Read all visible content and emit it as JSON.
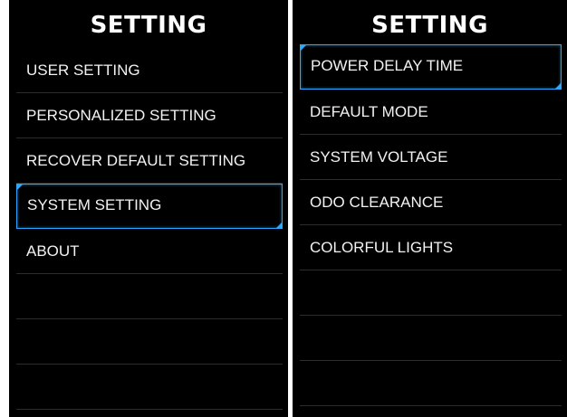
{
  "screens": [
    {
      "title": "SETTING",
      "items": [
        {
          "label": "USER SETTING",
          "selected": false
        },
        {
          "label": "PERSONALIZED SETTING",
          "selected": false
        },
        {
          "label": "RECOVER DEFAULT SETTING",
          "selected": false
        },
        {
          "label": "SYSTEM SETTING",
          "selected": true
        },
        {
          "label": "ABOUT",
          "selected": false
        }
      ]
    },
    {
      "title": "SETTING",
      "items": [
        {
          "label": "POWER DELAY TIME",
          "selected": true
        },
        {
          "label": "DEFAULT MODE",
          "selected": false
        },
        {
          "label": "SYSTEM VOLTAGE",
          "selected": false
        },
        {
          "label": "ODO CLEARANCE",
          "selected": false
        },
        {
          "label": "COLORFUL LIGHTS",
          "selected": false
        }
      ]
    }
  ],
  "colors": {
    "background": "#000000",
    "text": "#f2f2f2",
    "accent": "#2aa8ff",
    "divider": "#2c2c2c"
  }
}
